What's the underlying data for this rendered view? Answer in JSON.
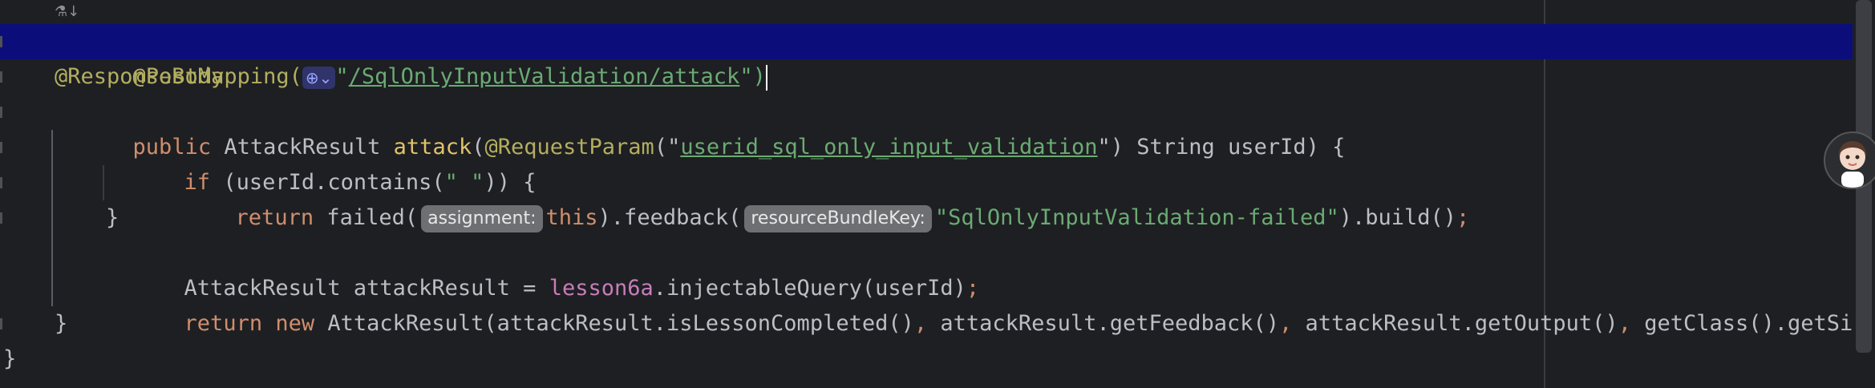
{
  "editor": {
    "top_hint": "⚗↓",
    "lines": [
      {
        "parts": {
          "a": "@PostMapping(",
          "b": "\"",
          "c": "/SqlOnlyInputValidation/attack",
          "d": "\")"
        }
      },
      {
        "text": "@ResponseBody"
      },
      {
        "parts": {
          "kw": "public",
          "t1": " AttackResult ",
          "m": "attack",
          "t2": "(",
          "ann": "@RequestParam",
          "t3": "(\"",
          "s": "userid_sql_only_input_validation",
          "t4": "\") String userId) {"
        }
      },
      {
        "parts": {
          "kw": "if",
          "t1": " (userId.contains(",
          "s": "\" \"",
          "t2": ")) {"
        }
      },
      {
        "parts": {
          "kw": "return",
          "t1": " failed(",
          "h1": "assignment:",
          "kw2": "this",
          "t2": ").feedback(",
          "h2": "resourceBundleKey:",
          "s": "\"SqlOnlyInputValidation-failed\"",
          "t3": ").build()",
          "semi": ";"
        }
      },
      {
        "text": "}"
      },
      {
        "parts": {
          "t1": "AttackResult attackResult = ",
          "f": "lesson6a",
          "t2": ".injectableQuery(userId)",
          "semi": ";"
        }
      },
      {
        "parts": {
          "kw": "return new",
          "t1": " AttackResult(attackResult.isLessonCompleted()",
          "c1": ",",
          "t2": " attackResult.getFeedback()",
          "c2": ",",
          "t3": " attackResult.getOutput()",
          "c3": ",",
          "t4": " getClass().getSimpleName()"
        }
      },
      {
        "text": "}"
      },
      {
        "text": "}"
      }
    ]
  },
  "icons": {
    "globe": "globe-icon",
    "avatar": "assistant-avatar-icon"
  },
  "colors": {
    "background": "#1e1f22",
    "current_line": "#0b0e7a",
    "annotation": "#b3ae60",
    "keyword": "#cf8e6d",
    "string": "#6aab73",
    "method": "#56a8f5",
    "field": "#c77dbb"
  }
}
